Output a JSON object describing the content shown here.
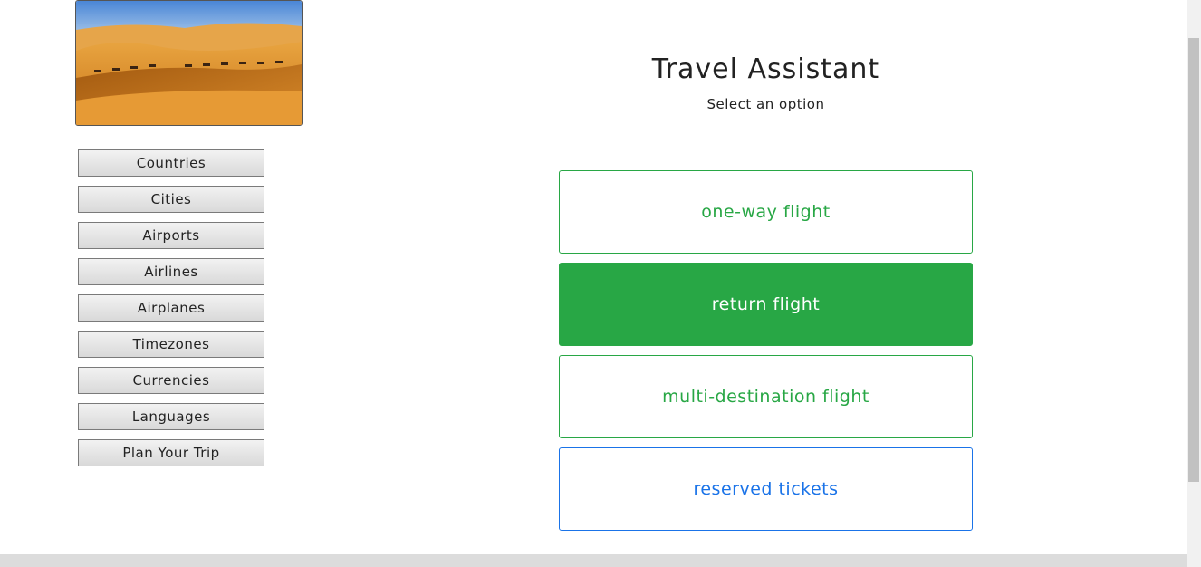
{
  "banner": {
    "alt": "Desert dunes with camel caravan"
  },
  "sidebar": {
    "items": [
      {
        "label": "Countries"
      },
      {
        "label": "Cities"
      },
      {
        "label": "Airports"
      },
      {
        "label": "Airlines"
      },
      {
        "label": "Airplanes"
      },
      {
        "label": "Timezones"
      },
      {
        "label": "Currencies"
      },
      {
        "label": "Languages"
      },
      {
        "label": "Plan Your Trip"
      }
    ]
  },
  "header": {
    "title": "Travel Assistant",
    "subtitle": "Select an option"
  },
  "options": [
    {
      "label": "one-way flight"
    },
    {
      "label": "return flight"
    },
    {
      "label": "multi-destination flight"
    },
    {
      "label": "reserved tickets"
    }
  ],
  "colors": {
    "accent_green": "#28a745",
    "accent_blue": "#1a73e8"
  }
}
